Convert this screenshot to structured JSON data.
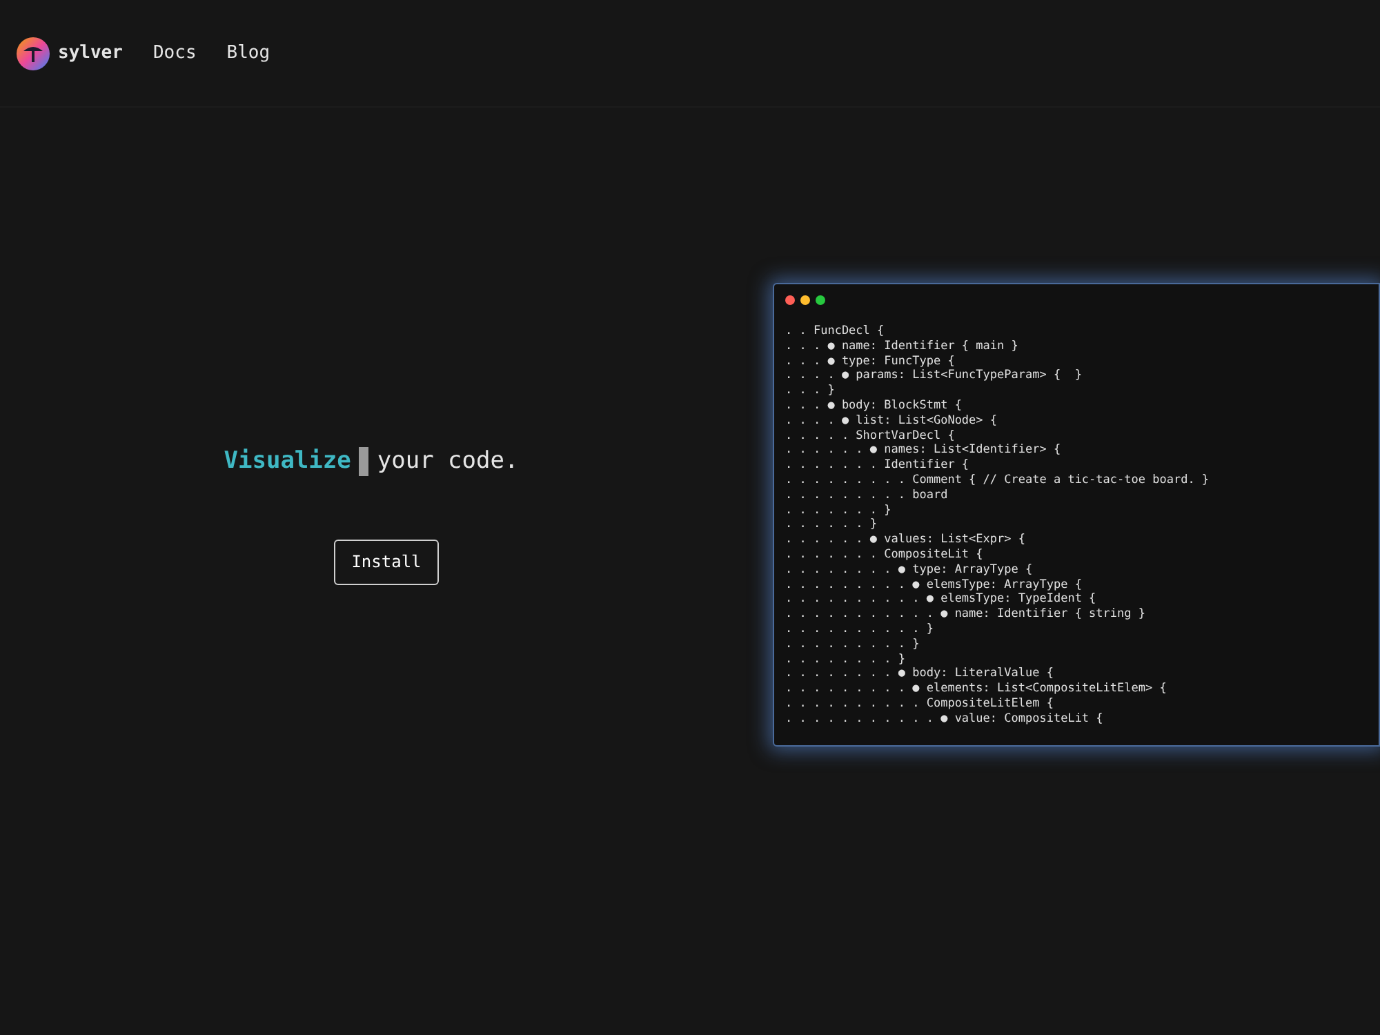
{
  "header": {
    "brand": "sylver",
    "nav": [
      "Docs",
      "Blog"
    ]
  },
  "hero": {
    "highlight": "Visualize",
    "rest": "your code.",
    "button": "Install"
  },
  "code_window": {
    "lines": [
      ". . FuncDecl {",
      ". . . ● name: Identifier { main }",
      ". . . ● type: FuncType {",
      ". . . . ● params: List<FuncTypeParam> {  }",
      ". . . }",
      ". . . ● body: BlockStmt {",
      ". . . . ● list: List<GoNode> {",
      ". . . . . ShortVarDecl {",
      ". . . . . . ● names: List<Identifier> {",
      ". . . . . . . Identifier {",
      ". . . . . . . . . Comment { // Create a tic-tac-toe board. }",
      ". . . . . . . . . board",
      ". . . . . . . }",
      ". . . . . . }",
      ". . . . . . ● values: List<Expr> {",
      ". . . . . . . CompositeLit {",
      ". . . . . . . . ● type: ArrayType {",
      ". . . . . . . . . ● elemsType: ArrayType {",
      ". . . . . . . . . . ● elemsType: TypeIdent {",
      ". . . . . . . . . . . ● name: Identifier { string }",
      ". . . . . . . . . . }",
      ". . . . . . . . . }",
      ". . . . . . . . }",
      ". . . . . . . . ● body: LiteralValue {",
      ". . . . . . . . . ● elements: List<CompositeLitElem> {",
      ". . . . . . . . . . CompositeLitElem {",
      ". . . . . . . . . . . ● value: CompositeLit {"
    ]
  }
}
